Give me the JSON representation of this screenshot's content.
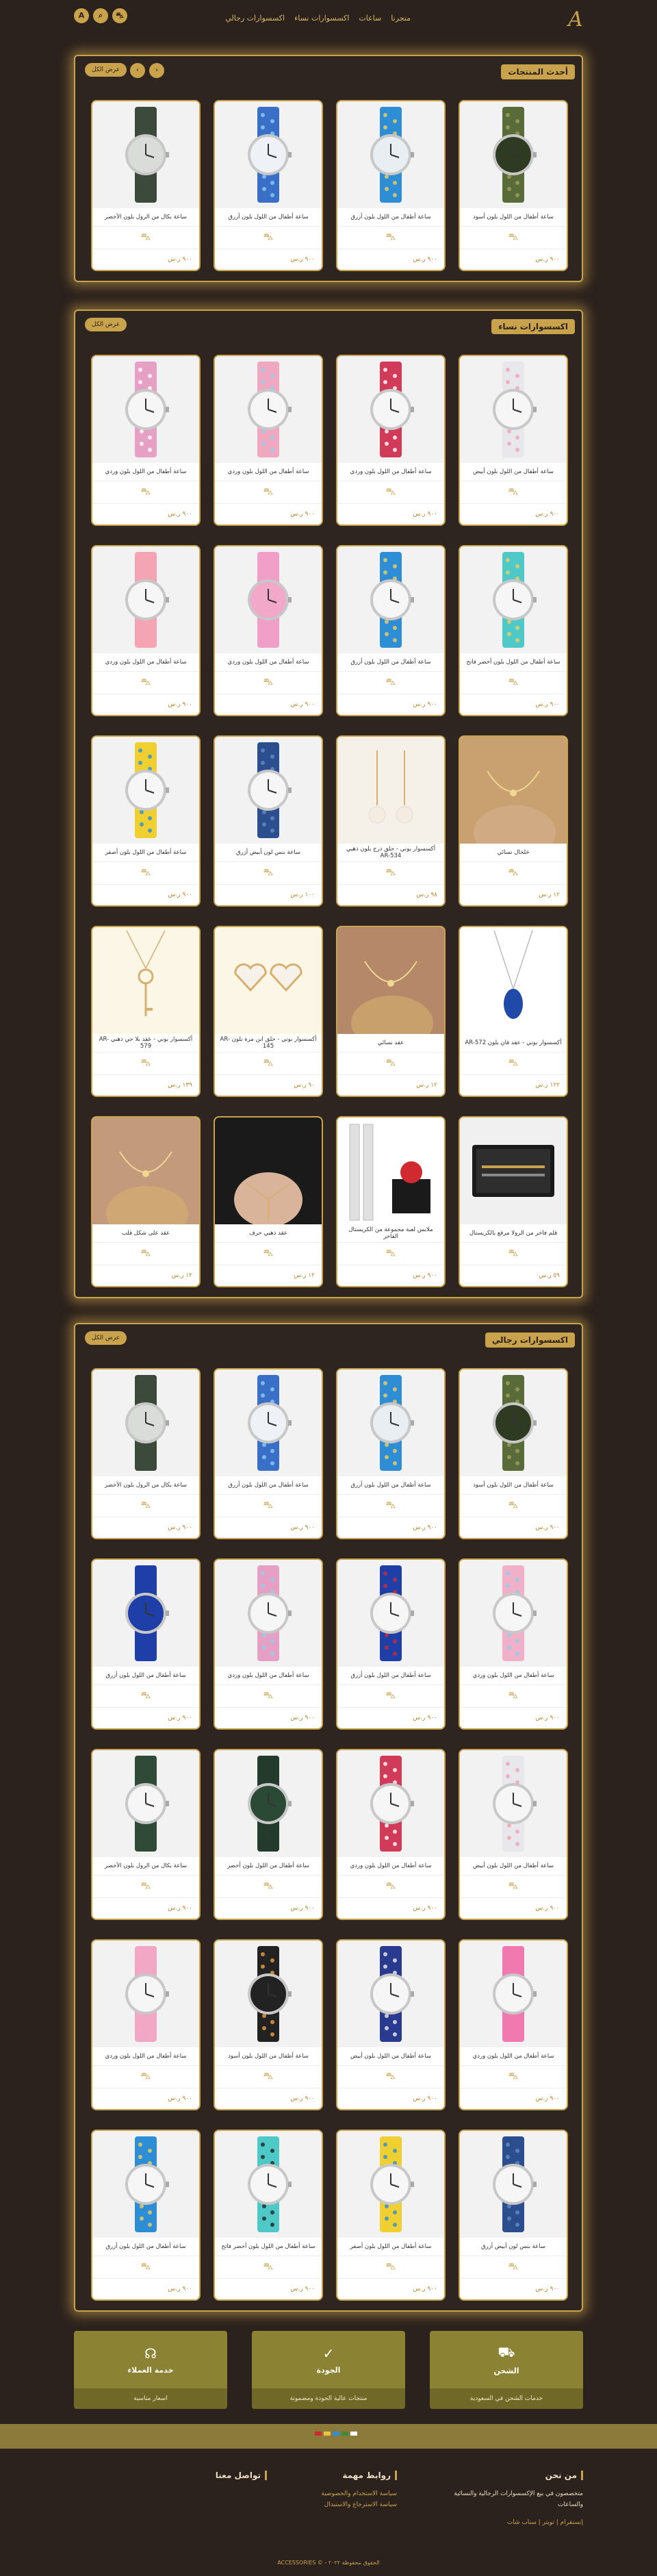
{
  "header": {
    "logo_text": "A",
    "nav": [
      "متجرنا",
      "ساعات",
      "اكسسوارات نساء",
      "اكسسوارات رجالي"
    ],
    "icons": [
      "user-icon",
      "search-icon",
      "cart-icon"
    ],
    "icon_glyphs": [
      "A",
      "⌕",
      "⛍"
    ]
  },
  "sections": [
    {
      "title": "أحدث المنتجات",
      "button": "عرض الكل",
      "arrows": [
        "‹",
        "›"
      ],
      "products": [
        {
          "name": "ساعة أطفال من اللول بلون أسود",
          "price": "٩٠٠ ر.س",
          "img": "watch",
          "color": "#5a6b3a",
          "dial": "#2f3a22",
          "pattern": "#a0a060"
        },
        {
          "name": "ساعة أطفال من اللول بلون أزرق",
          "price": "٩٠٠ ر.س",
          "img": "watch",
          "color": "#2d8ed6",
          "dial": "#e9eef2",
          "pattern": "#f0d060"
        },
        {
          "name": "ساعة أطفال من اللول بلون أزرق",
          "price": "٩٠٠ ر.س",
          "img": "watch",
          "color": "#3a6fc8",
          "dial": "#eef2f6",
          "pattern": "#8bd0f0"
        },
        {
          "name": "ساعة بكال من الرول بلون الأخضر",
          "price": "٩٠٠ ر.س",
          "img": "watch",
          "color": "#3b4a3a",
          "dial": "#d9dcd8",
          "pattern": "#3b4a3a"
        }
      ]
    },
    {
      "title": "اكسسوارات نساء",
      "button": "عرض الكل",
      "products": [
        {
          "name": "ساعة أطفال من اللول بلون أبيض",
          "price": "٩٠٠ ر.س",
          "img": "watch",
          "color": "#e8e8ec",
          "dial": "#f6f6f6",
          "pattern": "#f2a0b8"
        },
        {
          "name": "ساعة أطفال من اللول بلون وردي",
          "price": "٩٠٠ ر.س",
          "img": "watch",
          "color": "#d23a5a",
          "dial": "#f6f6f6",
          "pattern": "#ffffff"
        },
        {
          "name": "ساعة أطفال من اللول بلون وردي",
          "price": "٩٠٠ ر.س",
          "img": "watch",
          "color": "#f0a8c0",
          "dial": "#f6f6f6",
          "pattern": "#8bd0f0"
        },
        {
          "name": "ساعة أطفال من اللول بلون وردي",
          "price": "٩٠٠ ر.س",
          "img": "watch",
          "color": "#e6a0c4",
          "dial": "#f6f6f6",
          "pattern": "#ffffff"
        },
        {
          "name": "ساعة أطفال من اللول بلون أخضر فاتح",
          "price": "٩٠٠ ر.س",
          "img": "watch",
          "color": "#4fc8c8",
          "dial": "#f6f6f6",
          "pattern": "#f0d060"
        },
        {
          "name": "ساعة أطفال من اللول بلون أزرق",
          "price": "٩٠٠ ر.س",
          "img": "watch",
          "color": "#2d8ed6",
          "dial": "#f6f6f6",
          "pattern": "#f0d060"
        },
        {
          "name": "ساعة أطفال من اللول بلون وردي",
          "price": "٩٠٠ ر.س",
          "img": "watch",
          "color": "#f0a0c8",
          "dial": "#f2a8c8",
          "pattern": "#f0a0c8"
        },
        {
          "name": "ساعة أطفال من اللول بلون وردي",
          "price": "٩٠٠ ر.س",
          "img": "watch",
          "color": "#f5a4b4",
          "dial": "#f6f6f6",
          "pattern": "#f5a4b4"
        },
        {
          "name": "خلخال نسائي",
          "price": "١٢ ر.س",
          "img": "anklet",
          "color": "#c9a070",
          "dial": "#d4b090",
          "pattern": "#c9a070"
        },
        {
          "name": "أكسسوار بوني - حلق درج بلون ذهبي AR-534",
          "price": "٩٨ ر.س",
          "img": "earrings",
          "color": "#f5f0e8",
          "dial": "#d7b070",
          "pattern": "#f5f0e8"
        },
        {
          "name": "ساعة بنس لون أبيض أزرق",
          "price": "١٠٠ ر.س",
          "img": "watch",
          "color": "#2d4e8e",
          "dial": "#f6f6f6",
          "pattern": "#6090c0"
        },
        {
          "name": "ساعة أطفال من اللول بلون أصفر",
          "price": "٩٠٠ ر.س",
          "img": "watch",
          "color": "#f0d030",
          "dial": "#f6f6f6",
          "pattern": "#2d8ed6"
        },
        {
          "name": "أكسسوار بوني - عقد فان بلون AR-572",
          "price": "١٢٢ ر.س",
          "img": "necklace-blue",
          "color": "#ffffff",
          "dial": "#1f4aa8",
          "pattern": "#ffffff"
        },
        {
          "name": "عقد نسائي",
          "price": "١٢ ر.س",
          "img": "necklace-model",
          "color": "#b48868",
          "dial": "#d4b070",
          "pattern": "#b48868"
        },
        {
          "name": "أكسسوار بوني - حلق ابن مرة بلون AR-145",
          "price": "٩٠ ر.س",
          "img": "hearts",
          "color": "#fbf6e6",
          "dial": "#d7b070",
          "pattern": "#fbf6e6"
        },
        {
          "name": "أكسسوار بوني - عقد بلا جي ذهبي AR-579",
          "price": "١٣٩ ر.س",
          "img": "key",
          "color": "#fbf6e6",
          "dial": "#d7b070",
          "pattern": "#fbf6e6"
        },
        {
          "name": "قلم فاخر من الرولا مرقع بالكريستال",
          "price": "٥٩ ر.س",
          "img": "pen",
          "color": "#1a1a1a",
          "dial": "#c9a34c",
          "pattern": "#f0f0f0"
        },
        {
          "name": "ملابس لعبة مجموعة من الكريستال الفاخر",
          "price": "٩٠٠ ر.س",
          "img": "giftbox",
          "color": "#d02a30",
          "dial": "#e0e0e0",
          "pattern": "#1a1a1a"
        },
        {
          "name": "عقد ذهبي حرف",
          "price": "١٢ ر.س",
          "img": "necklace-dark",
          "color": "#1a1a1a",
          "dial": "#d7b070",
          "pattern": "#1a1a1a"
        },
        {
          "name": "عقد على شكل قلب",
          "price": "١٢ ر.س",
          "img": "necklace-skin",
          "color": "#c49a7c",
          "dial": "#d7b070",
          "pattern": "#c49a7c"
        }
      ]
    },
    {
      "title": "اكسسوارات رجالي",
      "button": "عرض الكل",
      "products": [
        {
          "name": "ساعة أطفال من اللول بلون أسود",
          "price": "٩٠٠ ر.س",
          "img": "watch",
          "color": "#5a6b3a",
          "dial": "#2f3a22",
          "pattern": "#a0a060"
        },
        {
          "name": "ساعة أطفال من اللول بلون أزرق",
          "price": "٩٠٠ ر.س",
          "img": "watch",
          "color": "#2d8ed6",
          "dial": "#e9eef2",
          "pattern": "#f0d060"
        },
        {
          "name": "ساعة أطفال من اللول بلون أزرق",
          "price": "٩٠٠ ر.س",
          "img": "watch",
          "color": "#3a6fc8",
          "dial": "#eef2f6",
          "pattern": "#8bd0f0"
        },
        {
          "name": "ساعة بكال من الرول بلون الأخضر",
          "price": "٩٠٠ ر.س",
          "img": "watch",
          "color": "#3b4a3a",
          "dial": "#d9dcd8",
          "pattern": "#3b4a3a"
        },
        {
          "name": "ساعة أطفال من اللول بلون وردي",
          "price": "٩٠٠ ر.س",
          "img": "watch",
          "color": "#f0b0c8",
          "dial": "#f6f6f6",
          "pattern": "#8bd0f0"
        },
        {
          "name": "ساعة أطفال من اللول بلون أزرق",
          "price": "٩٠٠ ر.س",
          "img": "watch",
          "color": "#1f3fa8",
          "dial": "#f6f6f6",
          "pattern": "#d02a30"
        },
        {
          "name": "ساعة أطفال من اللول بلون وردي",
          "price": "٩٠٠ ر.س",
          "img": "watch",
          "color": "#e6a0c4",
          "dial": "#f6f6f6",
          "pattern": "#8bd0f0"
        },
        {
          "name": "ساعة أطفال من اللول بلون أزرق",
          "price": "٩٠٠ ر.س",
          "img": "watch",
          "color": "#1f3fa8",
          "dial": "#1f3fa8",
          "pattern": "#1f3fa8"
        },
        {
          "name": "ساعة أطفال من اللول بلون أبيض",
          "price": "٩٠٠ ر.س",
          "img": "watch",
          "color": "#e8e8ec",
          "dial": "#f6f6f6",
          "pattern": "#f2a0b8"
        },
        {
          "name": "ساعة أطفال من اللول بلون وردي",
          "price": "٩٠٠ ر.س",
          "img": "watch",
          "color": "#d23a5a",
          "dial": "#f6f6f6",
          "pattern": "#ffffff"
        },
        {
          "name": "ساعة أطفال من اللول بلون أخضر",
          "price": "٩٠٠ ر.س",
          "img": "watch",
          "color": "#233a2c",
          "dial": "#2a4a36",
          "pattern": "#233a2c"
        },
        {
          "name": "ساعة بكال من الرول بلون الأخضر",
          "price": "٩٠٠ ر.س",
          "img": "watch",
          "color": "#2f4a36",
          "dial": "#f6f6f6",
          "pattern": "#2f4a36"
        },
        {
          "name": "ساعة أطفال من اللول بلون وردي",
          "price": "٩٠٠ ر.س",
          "img": "watch",
          "color": "#f07ab0",
          "dial": "#f6f6f6",
          "pattern": "#f07ab0"
        },
        {
          "name": "ساعة أطفال من اللول بلون أبيض",
          "price": "٩٠٠ ر.س",
          "img": "watch",
          "color": "#2a3a8e",
          "dial": "#f6f6f6",
          "pattern": "#f0f0f0"
        },
        {
          "name": "ساعة أطفال من اللول بلون أسود",
          "price": "٩٠٠ ر.س",
          "img": "watch",
          "color": "#222222",
          "dial": "#222222",
          "pattern": "#f0a040"
        },
        {
          "name": "ساعة أطفال من اللول بلون وردي",
          "price": "٩٠٠ ر.س",
          "img": "watch",
          "color": "#f2a8c4",
          "dial": "#f6f6f6",
          "pattern": "#f2a8c4"
        },
        {
          "name": "ساعة بنس لون أبيض أزرق",
          "price": "٩٠٠ ر.س",
          "img": "watch",
          "color": "#2d4e8e",
          "dial": "#f6f6f6",
          "pattern": "#6090c0"
        },
        {
          "name": "ساعة أطفال من اللول بلون أصفر",
          "price": "٩٠٠ ر.س",
          "img": "watch",
          "color": "#f0d030",
          "dial": "#f6f6f6",
          "pattern": "#2d8ed6"
        },
        {
          "name": "ساعة أطفال من اللول بلون أخضر فاتح",
          "price": "٩٠٠ ر.س",
          "img": "watch",
          "color": "#4fc8c8",
          "dial": "#f6f6f6",
          "pattern": "#222222"
        },
        {
          "name": "ساعة أطفال من اللول بلون أزرق",
          "price": "٩٠٠ ر.س",
          "img": "watch",
          "color": "#2d8ed6",
          "dial": "#f6f6f6",
          "pattern": "#f0d060"
        }
      ]
    }
  ],
  "features": [
    {
      "title": "الشحن",
      "sub": "خدمات الشحن في السعودية",
      "icon": "truck-icon",
      "glyph": "⛟"
    },
    {
      "title": "الجودة",
      "sub": "منتجات عالية الجودة ومضمونة",
      "icon": "check-icon",
      "glyph": "✓"
    },
    {
      "title": "خدمة العملاء",
      "sub": "اسعار مناسبة",
      "icon": "headset-icon",
      "glyph": "☊"
    }
  ],
  "footer": {
    "about_title": "من نحن",
    "about_text": "متخصصون في بيع الإكسسوارات الرجالية والنسائية والساعات",
    "social_text": "إنستقرام  |  تويتر  |  سناب شات",
    "links_title": "روابط مهمة",
    "links": [
      "سياسة الاستخدام والخصوصية",
      "سياسة الاسترجاع والاستبدال"
    ],
    "contact_title": "تواصل معنا",
    "copyright": "الحقوق محفوظة ٢٠٢٢ - © ACCESSORIES"
  },
  "colors": {
    "brand": "#c9a34c",
    "background": "#2c221d",
    "feature": "#8b8233"
  },
  "payment_colors": [
    "#d02a30",
    "#f0c040",
    "#2d8ed6",
    "#3a8a3a",
    "#ffffff"
  ]
}
